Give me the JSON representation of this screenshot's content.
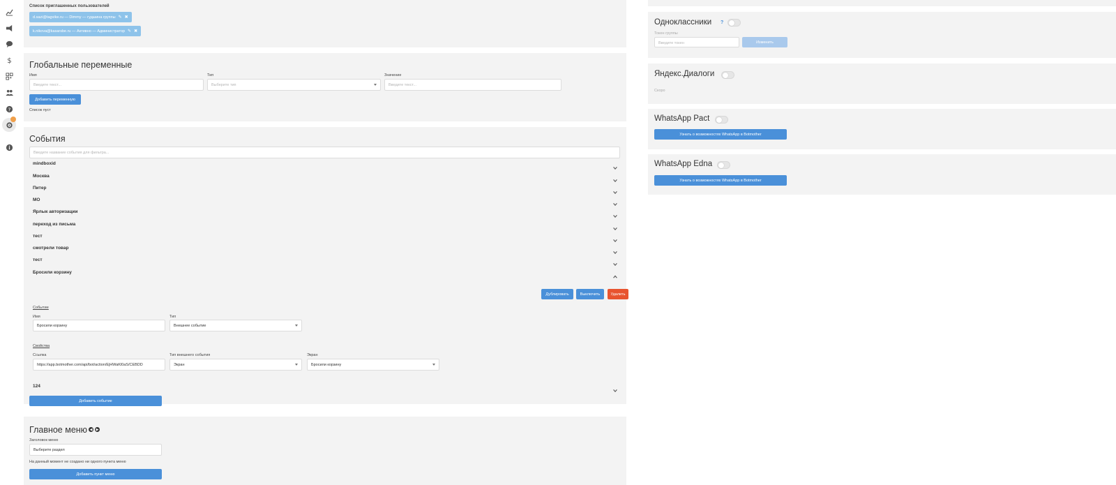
{
  "sidebar": {
    "icons": [
      "chart-icon",
      "megaphone-icon",
      "chat-icon",
      "dollar-icon",
      "qr-icon",
      "users-icon",
      "help-icon",
      "settings-icon",
      "info-icon"
    ]
  },
  "invited": {
    "title": "Список приглашенных пользователей",
    "users": [
      "d.sazi@tagvike.ru — Dimmy — гудшина группы",
      "k.nikova@kasarsbe.ru — Активно — Администратор"
    ]
  },
  "globals": {
    "title": "Глобальные переменные",
    "name_label": "Имя",
    "name_placeholder": "Введите текст...",
    "type_label": "Тип",
    "type_placeholder": "Выберите тип",
    "value_label": "Значение",
    "value_placeholder": "Введите текст...",
    "add_button": "Добавить переменную",
    "empty_text": "Список пуст"
  },
  "events": {
    "title": "События",
    "filter_placeholder": "Введите название события для фильтра...",
    "items": [
      "mindboxid",
      "Москва",
      "Питер",
      "МО",
      "Ярлык авторизации",
      "переход из письма",
      "тест",
      "смотрели товар",
      "тест",
      "Бросили корзину"
    ],
    "expanded": {
      "duplicate_button": "Дублировать",
      "disable_button": "Выключить",
      "delete_button": "Удалить",
      "event_section": "Событие",
      "name_label": "Имя",
      "name_value": "Бросили корзину",
      "type_label": "Тип",
      "type_value": "Внешнее событие",
      "props_section": "Свойства",
      "link_label": "Ссылка",
      "link_value": "https://app.botmother.com/api/bot/action/EjHWaKl0aS/CEBDD",
      "ext_type_label": "Тип внешнего события",
      "ext_type_value": "Экран",
      "screen_label": "Экран",
      "screen_value": "Бросили корзину"
    },
    "last_item": "124",
    "add_button": "Добавить событие"
  },
  "main_menu": {
    "title": "Главное меню",
    "header_label": "Заголовок меню",
    "header_value": "Выберите раздел",
    "empty_text": "На данный момент не создано ни одного пункта меню",
    "add_button": "Добавить пункт меню"
  },
  "integrations": {
    "ok": {
      "title": "Одноклассники",
      "help": "?",
      "group_label": "Токен группы",
      "group_placeholder": "Введите токен",
      "save_button": "Изменить"
    },
    "yandex": {
      "title": "Яндекс.Диалоги",
      "sub": "Скоро"
    },
    "wa_pact": {
      "title": "WhatsApp Pact",
      "button": "Узнать о возможностях WhatsApp в Botmother"
    },
    "wa_edna": {
      "title": "WhatsApp Edna",
      "button": "Узнать о возможностях WhatsApp в Botmother"
    }
  },
  "colors": {
    "accent": "#4a90d9",
    "danger": "#e8542f",
    "panel": "#f3f3f3",
    "badge": "#f0a04b"
  }
}
